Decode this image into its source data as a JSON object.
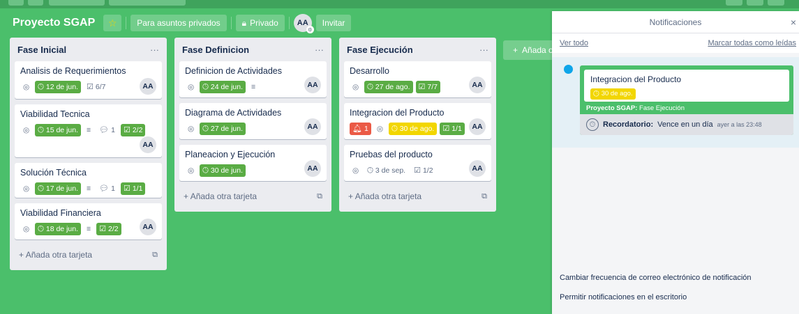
{
  "board": {
    "title": "Proyecto SGAP",
    "star_icon": "star-icon",
    "visibility_team": "Para asuntos privados",
    "visibility": "Privado",
    "member_initials": "AA",
    "invite": "Invitar"
  },
  "lists": [
    {
      "title": "Fase Inicial",
      "menu": "···",
      "cards": [
        {
          "title": "Analisis de Requerimientos",
          "due": "12 de jun.",
          "checklist": "6/7",
          "checklist_complete": false,
          "member": "AA"
        },
        {
          "title": "Viabilidad Tecnica",
          "due": "15 de jun.",
          "comments": "1",
          "checklist": "2/2",
          "member": "AA"
        },
        {
          "title": "Solución Técnica",
          "due": "17 de jun.",
          "comments": "1",
          "checklist": "1/1"
        },
        {
          "title": "Viabilidad Financiera",
          "due": "18 de jun.",
          "checklist": "2/2",
          "member": "AA"
        }
      ],
      "add_card": "Añada otra tarjeta"
    },
    {
      "title": "Fase Definicion",
      "menu": "···",
      "cards": [
        {
          "title": "Definicion de Actividades",
          "due": "24 de jun.",
          "member": "AA"
        },
        {
          "title": "Diagrama de Actividades",
          "due": "27 de jun.",
          "member": "AA"
        },
        {
          "title": "Planeacion y Ejecución",
          "due": "30 de jun.",
          "member": "AA"
        }
      ],
      "add_card": "Añada otra tarjeta"
    },
    {
      "title": "Fase Ejecución",
      "menu": "···",
      "cards": [
        {
          "title": "Desarrollo",
          "due": "27 de ago.",
          "checklist": "7/7",
          "member": "AA"
        },
        {
          "title": "Integracion del Producto",
          "alerts": "1",
          "due": "30 de ago.",
          "checklist": "1/1",
          "member": "AA"
        },
        {
          "title": "Pruebas del producto",
          "due": "3 de sep.",
          "checklist": "1/2",
          "member": "AA"
        }
      ],
      "add_card": "Añada otra tarjeta"
    }
  ],
  "add_list": "Añada o",
  "notifications": {
    "title": "Notificaciones",
    "close": "×",
    "view_all": "Ver todo",
    "mark_all_read": "Marcar todas como leídas",
    "item": {
      "card_title": "Integracion del Producto",
      "due": "30 de ago.",
      "board": "Proyecto SGAP:",
      "list": "Fase Ejecución",
      "reminder_label": "Recordatorio:",
      "reminder_text": "Vence en un día",
      "time": "ayer a las 23:48"
    },
    "email_frequency": "Cambiar frecuencia de correo electrónico de notificación",
    "desktop": "Permitir notificaciones en el escritorio"
  },
  "colors": {
    "board_bg": "#4bbf6b",
    "badge_green": "#5aac44",
    "badge_yellow": "#f2d600",
    "badge_red": "#eb5a46"
  }
}
